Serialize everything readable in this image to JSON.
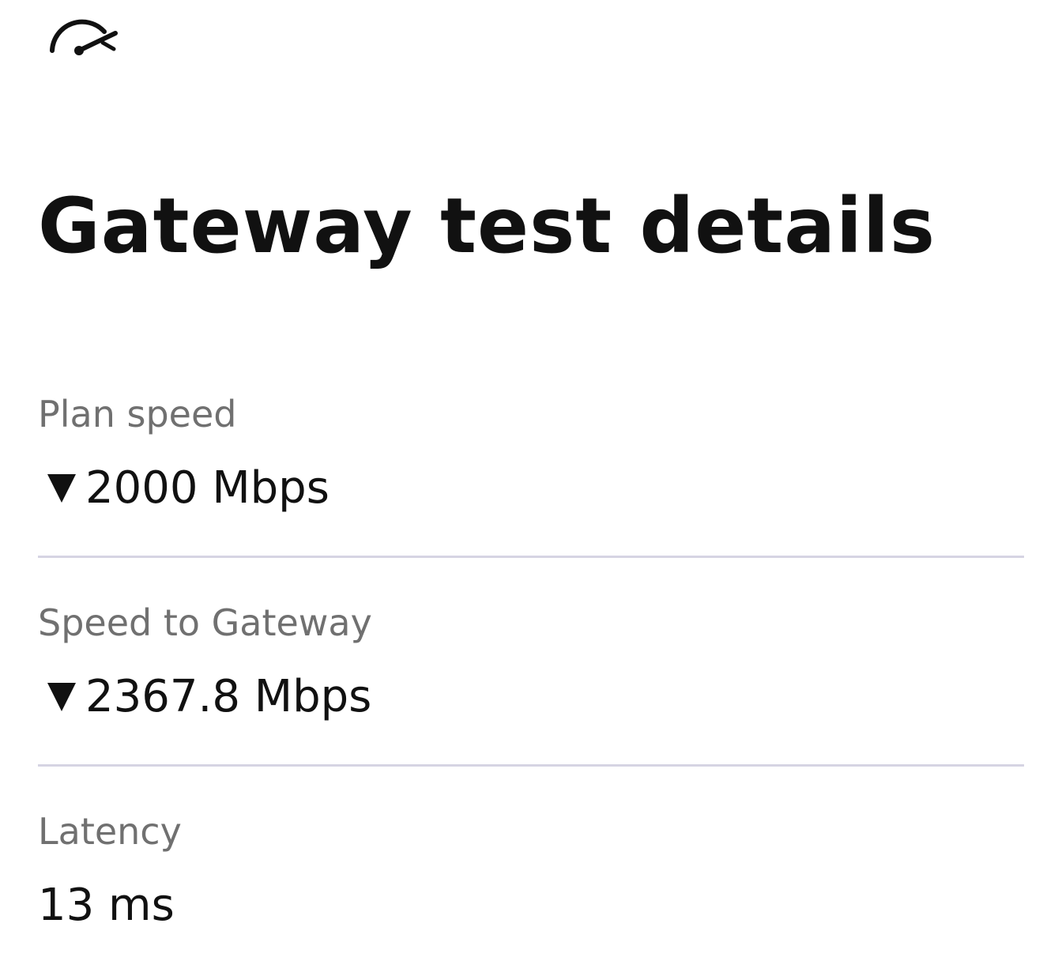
{
  "header": {
    "icon": "speedometer-icon"
  },
  "title": "Gateway test details",
  "details": [
    {
      "label": "Plan speed",
      "value": "2000 Mbps",
      "icon": "download-arrow-icon"
    },
    {
      "label": "Speed to Gateway",
      "value": "2367.8 Mbps",
      "icon": "download-arrow-icon"
    },
    {
      "label": "Latency",
      "value": "13 ms"
    }
  ],
  "colors": {
    "text": "#111111",
    "label": "#707070",
    "divider": "#d6d4e3",
    "background": "#ffffff"
  }
}
